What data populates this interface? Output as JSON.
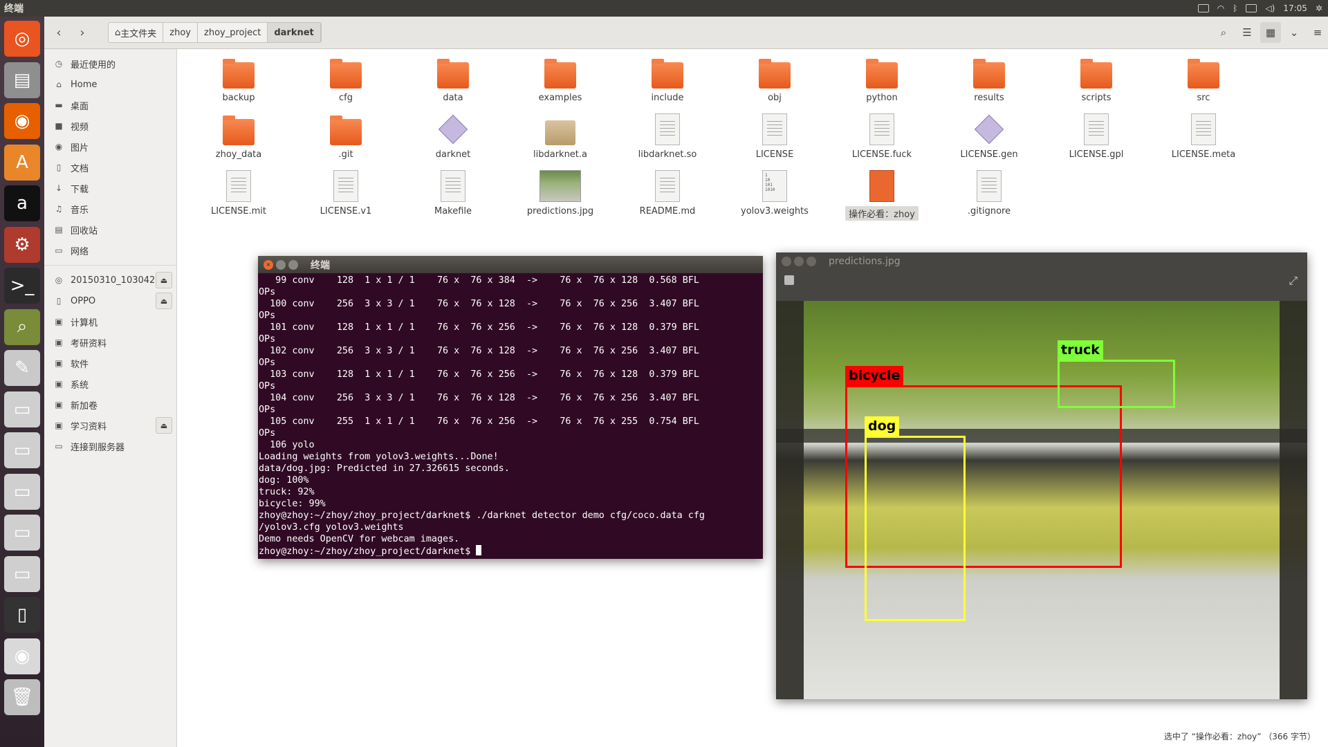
{
  "topbar": {
    "title": "终端",
    "time": "17:05"
  },
  "launcher": [
    "ubuntu-dash-icon",
    "files-icon",
    "firefox-icon",
    "software-center-icon",
    "amazon-icon",
    "settings-icon",
    "terminal-icon",
    "image-viewer-icon",
    "text-editor-icon",
    "drive-icon",
    "drive-icon",
    "drive-icon",
    "drive-icon",
    "drive-icon",
    "phone-icon",
    "dvd-icon",
    "trash-icon"
  ],
  "toolbar": {
    "crumbs": [
      "主文件夹",
      "zhoy",
      "zhoy_project",
      "darknet"
    ]
  },
  "sidebar": {
    "places": [
      {
        "icon": "◷",
        "label": "最近使用的"
      },
      {
        "icon": "⌂",
        "label": "Home"
      },
      {
        "icon": "▬",
        "label": "桌面"
      },
      {
        "icon": "■",
        "label": "视频"
      },
      {
        "icon": "◉",
        "label": "图片"
      },
      {
        "icon": "▯",
        "label": "文档"
      },
      {
        "icon": "↓",
        "label": "下载"
      },
      {
        "icon": "♫",
        "label": "音乐"
      },
      {
        "icon": "▤",
        "label": "回收站"
      },
      {
        "icon": "▭",
        "label": "网络"
      }
    ],
    "devices": [
      {
        "icon": "◎",
        "label": "20150310_103042",
        "eject": true
      },
      {
        "icon": "▯",
        "label": "OPPO",
        "eject": true
      },
      {
        "icon": "▣",
        "label": "计算机",
        "eject": false
      },
      {
        "icon": "▣",
        "label": "考研资料",
        "eject": false
      },
      {
        "icon": "▣",
        "label": "软件",
        "eject": false
      },
      {
        "icon": "▣",
        "label": "系统",
        "eject": false
      },
      {
        "icon": "▣",
        "label": "新加卷",
        "eject": false
      },
      {
        "icon": "▣",
        "label": "学习资料",
        "eject": true
      },
      {
        "icon": "▭",
        "label": "连接到服务器",
        "eject": false
      }
    ]
  },
  "files": [
    {
      "name": "backup",
      "type": "folder"
    },
    {
      "name": "cfg",
      "type": "folder"
    },
    {
      "name": "data",
      "type": "folder"
    },
    {
      "name": "examples",
      "type": "folder"
    },
    {
      "name": "include",
      "type": "folder"
    },
    {
      "name": "obj",
      "type": "folder"
    },
    {
      "name": "python",
      "type": "folder"
    },
    {
      "name": "results",
      "type": "folder"
    },
    {
      "name": "scripts",
      "type": "folder"
    },
    {
      "name": "src",
      "type": "folder"
    },
    {
      "name": "zhoy_data",
      "type": "folder"
    },
    {
      "name": ".git",
      "type": "folder"
    },
    {
      "name": "darknet",
      "type": "exec"
    },
    {
      "name": "libdarknet.a",
      "type": "pkg"
    },
    {
      "name": "libdarknet.so",
      "type": "doc"
    },
    {
      "name": "LICENSE",
      "type": "doc"
    },
    {
      "name": "LICENSE.fuck",
      "type": "doc"
    },
    {
      "name": "LICENSE.gen",
      "type": "exec"
    },
    {
      "name": "LICENSE.gpl",
      "type": "doc"
    },
    {
      "name": "LICENSE.meta",
      "type": "doc"
    },
    {
      "name": "LICENSE.mit",
      "type": "doc"
    },
    {
      "name": "LICENSE.v1",
      "type": "doc"
    },
    {
      "name": "Makefile",
      "type": "doc"
    },
    {
      "name": "predictions.jpg",
      "type": "image"
    },
    {
      "name": "README.md",
      "type": "doc"
    },
    {
      "name": "yolov3.weights",
      "type": "bin"
    },
    {
      "name": "操作必看：zhoy",
      "type": "orange",
      "selected": true
    },
    {
      "name": ".gitignore",
      "type": "doc"
    }
  ],
  "terminal": {
    "title": "终端",
    "lines": [
      "   99 conv    128  1 x 1 / 1    76 x  76 x 384  ->    76 x  76 x 128  0.568 BFL",
      "OPs",
      "  100 conv    256  3 x 3 / 1    76 x  76 x 128  ->    76 x  76 x 256  3.407 BFL",
      "OPs",
      "  101 conv    128  1 x 1 / 1    76 x  76 x 256  ->    76 x  76 x 128  0.379 BFL",
      "OPs",
      "  102 conv    256  3 x 3 / 1    76 x  76 x 128  ->    76 x  76 x 256  3.407 BFL",
      "OPs",
      "  103 conv    128  1 x 1 / 1    76 x  76 x 256  ->    76 x  76 x 128  0.379 BFL",
      "OPs",
      "  104 conv    256  3 x 3 / 1    76 x  76 x 128  ->    76 x  76 x 256  3.407 BFL",
      "OPs",
      "  105 conv    255  1 x 1 / 1    76 x  76 x 256  ->    76 x  76 x 255  0.754 BFL",
      "OPs",
      "  106 yolo",
      "Loading weights from yolov3.weights...Done!",
      "data/dog.jpg: Predicted in 27.326615 seconds.",
      "dog: 100%",
      "truck: 92%",
      "bicycle: 99%",
      "zhoy@zhoy:~/zhoy/zhoy_project/darknet$ ./darknet detector demo cfg/coco.data cfg",
      "/yolov3.cfg yolov3.weights",
      "Demo needs OpenCV for webcam images."
    ],
    "prompt": "zhoy@zhoy:~/zhoy/zhoy_project/darknet$ "
  },
  "viewer": {
    "title": "predictions.jpg",
    "detections": [
      {
        "label": "bicycle",
        "color": "#ff0000"
      },
      {
        "label": "truck",
        "color": "#7fff3a"
      },
      {
        "label": "dog",
        "color": "#ffff33"
      }
    ]
  },
  "statusbar": {
    "text": "选中了 “操作必看：zhoy” （366 字节）"
  }
}
